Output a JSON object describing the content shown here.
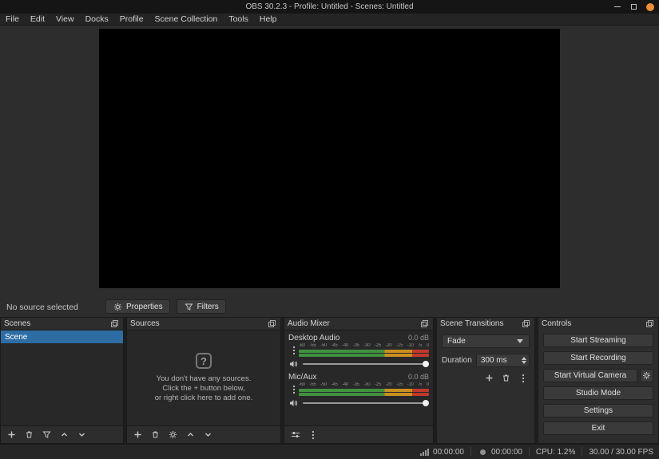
{
  "colors": {
    "close": "#ef8d32",
    "selection": "#2e6da4",
    "meter_green": "#3f923f",
    "meter_yellow": "#c98f1e",
    "meter_red": "#c0392b"
  },
  "window": {
    "title": "OBS 30.2.3 - Profile: Untitled - Scenes: Untitled"
  },
  "menubar": {
    "items": [
      "File",
      "Edit",
      "View",
      "Docks",
      "Profile",
      "Scene Collection",
      "Tools",
      "Help"
    ]
  },
  "preview": {
    "no_source_label": "No source selected",
    "properties_button": "Properties",
    "filters_button": "Filters"
  },
  "scenes": {
    "title": "Scenes",
    "items": [
      {
        "label": "Scene"
      }
    ]
  },
  "sources": {
    "title": "Sources",
    "empty_icon": "?",
    "empty_line1": "You don't have any sources.",
    "empty_line2": "Click the + button below,",
    "empty_line3": "or right click here to add one."
  },
  "mixer": {
    "title": "Audio Mixer",
    "channels": [
      {
        "name": "Desktop Audio",
        "level": "0.0 dB"
      },
      {
        "name": "Mic/Aux",
        "level": "0.0 dB"
      }
    ],
    "scale": [
      "-60",
      "-55",
      "-50",
      "-45",
      "-40",
      "-35",
      "-30",
      "-25",
      "-20",
      "-15",
      "-10",
      "-5",
      "0"
    ]
  },
  "transitions": {
    "title": "Scene Transitions",
    "selected": "Fade",
    "duration_label": "Duration",
    "duration_value": "300 ms"
  },
  "controls": {
    "title": "Controls",
    "buttons": [
      "Start Streaming",
      "Start Recording",
      "Start Virtual Camera",
      "Studio Mode",
      "Settings",
      "Exit"
    ]
  },
  "statusbar": {
    "stream_time": "00:00:00",
    "rec_time": "00:00:00",
    "cpu": "CPU: 1.2%",
    "fps": "30.00 / 30.00 FPS"
  }
}
